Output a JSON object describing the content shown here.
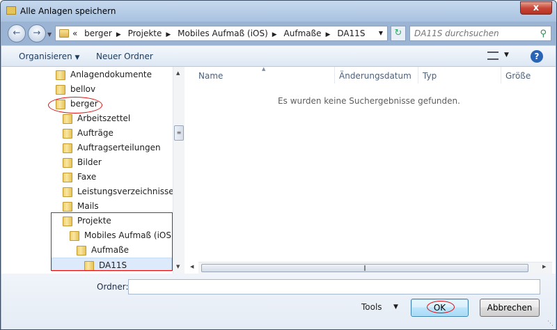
{
  "window": {
    "title": "Alle Anlagen speichern",
    "close_label": "x"
  },
  "address": {
    "back_icon": "back-arrow-icon",
    "forward_icon": "forward-arrow-icon",
    "overflow": "«",
    "crumbs": [
      "berger",
      "Projekte",
      "Mobiles Aufmaß (iOS)",
      "Aufmaße",
      "DA11S"
    ]
  },
  "search": {
    "placeholder": "DA11S durchsuchen"
  },
  "toolbar": {
    "organize_label": "Organisieren",
    "new_folder_label": "Neuer Ordner",
    "help_label": "?"
  },
  "tree": {
    "items": [
      {
        "label": "Anlagendokumente",
        "level": 0
      },
      {
        "label": "bellov",
        "level": 0
      },
      {
        "label": "berger",
        "level": 0
      },
      {
        "label": "Arbeitszettel",
        "level": 1
      },
      {
        "label": "Aufträge",
        "level": 1
      },
      {
        "label": "Auftragserteilungen",
        "level": 1
      },
      {
        "label": "Bilder",
        "level": 1
      },
      {
        "label": "Faxe",
        "level": 1
      },
      {
        "label": "Leistungsverzeichnisse",
        "level": 1
      },
      {
        "label": "Mails",
        "level": 1
      },
      {
        "label": "Projekte",
        "level": 1
      },
      {
        "label": "Mobiles Aufmaß (iOS)",
        "level": 2
      },
      {
        "label": "Aufmaße",
        "level": 3
      },
      {
        "label": "DA11S",
        "level": 4
      }
    ]
  },
  "list": {
    "columns": [
      "Name",
      "Änderungsdatum",
      "Typ",
      "Größe"
    ],
    "empty_message": "Es wurden keine Suchergebnisse gefunden."
  },
  "footer": {
    "folder_label": "Ordner:",
    "folder_value": "",
    "tools_label": "Tools",
    "ok_label": "OK",
    "cancel_label": "Abbrechen"
  },
  "colors": {
    "highlight": "#e01010",
    "selection_bg": "#dceafc"
  }
}
